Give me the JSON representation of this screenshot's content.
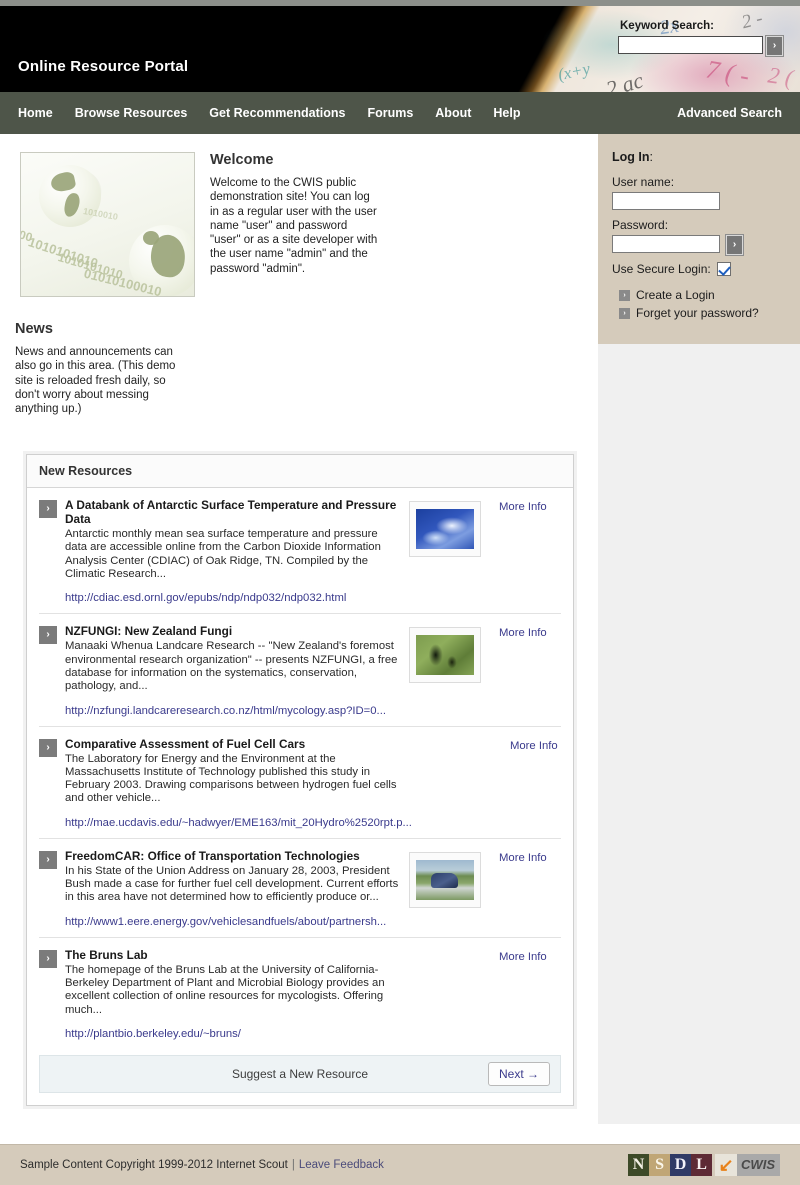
{
  "banner": {
    "site_title": "Online Resource Portal",
    "keyword_search": {
      "label": "Keyword Search:",
      "value": "",
      "placeholder": "",
      "submit_label": "›"
    },
    "scribbles": [
      "(x+y",
      "2 ac",
      "2x",
      "7 ( -",
      "2 -",
      "2 ("
    ]
  },
  "nav": {
    "items": [
      {
        "label": "Home"
      },
      {
        "label": "Browse Resources"
      },
      {
        "label": "Get Recommendations"
      },
      {
        "label": "Forums"
      },
      {
        "label": "About"
      },
      {
        "label": "Help"
      }
    ],
    "advanced_search": "Advanced Search"
  },
  "welcome": {
    "heading": "Welcome",
    "body": "Welcome to the CWIS public demonstration site! You can log in as a regular user with the user name \"user\" and password \"user\" or as a site developer with the user name \"admin\" and the password \"admin\".",
    "image_alt": "globes-binary-image",
    "binary_lines": [
      "00",
      "1010101010",
      "1010101010",
      "01010100010",
      "1010010"
    ]
  },
  "news": {
    "heading": "News",
    "body": "News and announcements can also go in this area. (This demo site is reloaded fresh daily, so don't worry about messing anything up.)"
  },
  "login": {
    "title_bold": "Log In",
    "title_colon": ":",
    "username_label": "User name:",
    "username_value": "",
    "password_label": "Password:",
    "password_value": "",
    "submit_label": "›",
    "secure_label": "Use Secure Login:",
    "secure_checked": true,
    "links": [
      {
        "label": "Create a Login",
        "bullet": "›"
      },
      {
        "label": "Forget your password?",
        "bullet": "›"
      }
    ]
  },
  "resources": {
    "header": "New Resources",
    "more_info_label": "More Info",
    "bullet": "›",
    "items": [
      {
        "title": "A Databank of Antarctic Surface Temperature and Pressure Data",
        "description": "Antarctic monthly mean sea surface temperature and pressure data are accessible online from the Carbon Dioxide Information Analysis Center (CDIAC) of Oak Ridge, TN. Compiled by the Climatic Research...",
        "url": "http://cdiac.esd.ornl.gov/epubs/ndp/ndp032/ndp032.html",
        "thumb": "sky-clouds-thumbnail",
        "has_thumb": true
      },
      {
        "title": "NZFUNGI: New Zealand Fungi",
        "description": "Manaaki Whenua Landcare Research -- \"New Zealand's foremost environmental research organization\" -- presents NZFUNGI, a free database for information on the systematics, conservation, pathology, and...",
        "url": "http://nzfungi.landcareresearch.co.nz/html/mycology.asp?ID=0...",
        "thumb": "fungi-green-thumbnail",
        "has_thumb": true
      },
      {
        "title": "Comparative Assessment of Fuel Cell Cars",
        "description": "The Laboratory for Energy and the Environment at the Massachusetts Institute of Technology published this study in February 2003. Drawing comparisons between hydrogen fuel cells and other vehicle...",
        "url": "http://mae.ucdavis.edu/~hadwyer/EME163/mit_20Hydro%2520rpt.p...",
        "thumb": "",
        "has_thumb": false
      },
      {
        "title": "FreedomCAR: Office of Transportation Technologies",
        "description": "In his State of the Union Address on January 28, 2003, President Bush made a case for further fuel cell development. Current efforts in this area have not determined how to efficiently produce or...",
        "url": "http://www1.eere.energy.gov/vehiclesandfuels/about/partnersh...",
        "thumb": "blue-car-thumbnail",
        "has_thumb": true
      },
      {
        "title": "The Bruns Lab",
        "description": "The homepage of the Bruns Lab at the University of California-Berkeley Department of Plant and Microbial Biology provides an excellent collection of online resources for mycologists. Offering much...",
        "url": "http://plantbio.berkeley.edu/~bruns/",
        "thumb": "",
        "has_thumb": false
      }
    ],
    "suggest_label": "Suggest a New Resource",
    "next_label": "Next →"
  },
  "footer": {
    "copyright": "Sample Content Copyright 1999-2012 Internet Scout",
    "separator": "|",
    "feedback_label": "Leave Feedback",
    "nsdl_letters": [
      "N",
      "S",
      "D",
      "L"
    ],
    "cwis_label": "CWIS"
  },
  "colors": {
    "nav_bar": "#4e5549",
    "banner": "#000000",
    "login_panel": "#d5cbbb",
    "footer": "#d5cbbb",
    "link": "#3a3a8c",
    "bullet_gray": "#7b7b7b"
  }
}
